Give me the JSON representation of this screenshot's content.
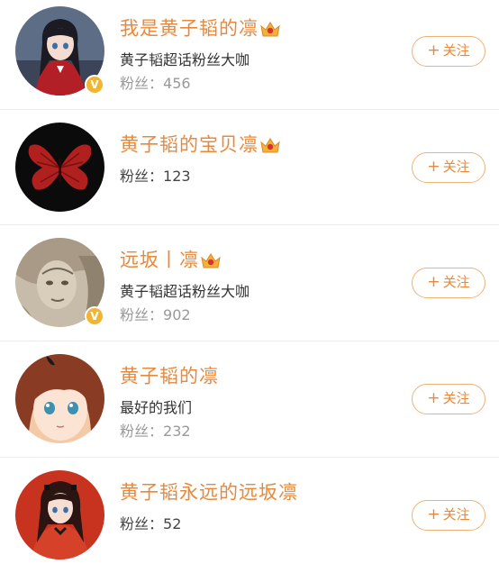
{
  "follow_plus": "+",
  "colors": {
    "accent": "#e8883a",
    "button_border": "#efb276",
    "verified_badge": "#f2b433",
    "muted_text": "#999999"
  },
  "users": [
    {
      "name": "我是黄子韬的凛",
      "has_crown": true,
      "description": "黄子韬超话粉丝大咖",
      "fans_label": "粉丝：",
      "fans_count": "456",
      "verified": true,
      "verified_glyph": "V",
      "follow_label": "关注",
      "avatar_icon": "anime-girl-red-sweater-avatar"
    },
    {
      "name": "黄子韬的宝贝凛",
      "has_crown": true,
      "description": "",
      "fans_label": "粉丝：",
      "fans_count": "123",
      "verified": false,
      "follow_label": "关注",
      "avatar_icon": "red-butterfly-avatar"
    },
    {
      "name": "远坂丨凛",
      "has_crown": true,
      "description": "黄子韬超话粉丝大咖",
      "fans_label": "粉丝：",
      "fans_count": "902",
      "verified": true,
      "verified_glyph": "V",
      "follow_label": "关注",
      "avatar_icon": "sketch-portrait-avatar"
    },
    {
      "name": "黄子韬的凛",
      "has_crown": false,
      "description": "最好的我们",
      "fans_label": "粉丝：",
      "fans_count": "232",
      "verified": false,
      "follow_label": "关注",
      "avatar_icon": "anime-girl-closeup-avatar"
    },
    {
      "name": "黄子韬永远的远坂凛",
      "has_crown": false,
      "description": "",
      "fans_label": "粉丝：",
      "fans_count": "52",
      "verified": false,
      "follow_label": "关注",
      "avatar_icon": "anime-girl-red-outfit-avatar"
    }
  ]
}
